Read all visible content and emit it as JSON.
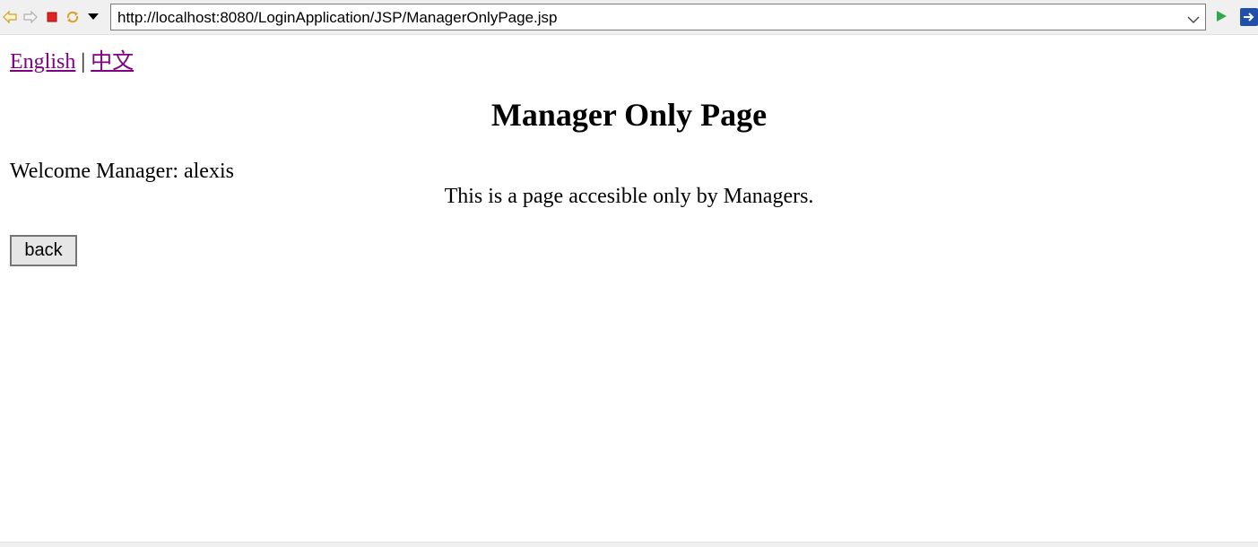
{
  "toolbar": {
    "url": "http://localhost:8080/LoginApplication/JSP/ManagerOnlyPage.jsp",
    "icons": [
      "back-arrow-icon",
      "forward-arrow-icon",
      "stop-icon",
      "refresh-icon",
      "dropdown-icon",
      "go-icon",
      "external-browser-icon"
    ]
  },
  "language": {
    "english": "English",
    "separator": "|",
    "chinese": "中文"
  },
  "page": {
    "title": "Manager Only Page",
    "welcome": "Welcome Manager: alexis",
    "note": "This is a page accesible only by Managers.",
    "back_label": "back"
  },
  "colors": {
    "visited_link": "#800080",
    "toolbar_bg": "#f0f0f0"
  }
}
